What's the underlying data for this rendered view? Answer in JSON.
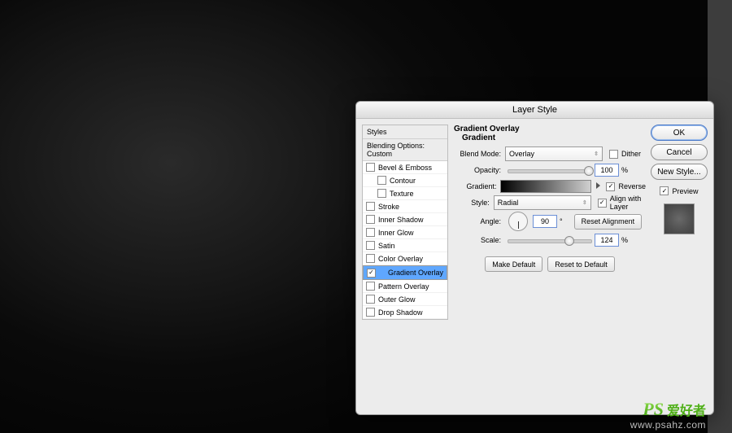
{
  "dialog": {
    "title": "Layer Style",
    "left_panel": {
      "header1": "Styles",
      "header2": "Blending Options: Custom",
      "items": [
        {
          "label": "Bevel & Emboss",
          "checked": false,
          "sub": false
        },
        {
          "label": "Contour",
          "checked": false,
          "sub": true
        },
        {
          "label": "Texture",
          "checked": false,
          "sub": true
        },
        {
          "label": "Stroke",
          "checked": false,
          "sub": false
        },
        {
          "label": "Inner Shadow",
          "checked": false,
          "sub": false
        },
        {
          "label": "Inner Glow",
          "checked": false,
          "sub": false
        },
        {
          "label": "Satin",
          "checked": false,
          "sub": false
        },
        {
          "label": "Color Overlay",
          "checked": false,
          "sub": false
        },
        {
          "label": "Gradient Overlay",
          "checked": true,
          "sub": false,
          "selected": true
        },
        {
          "label": "Pattern Overlay",
          "checked": false,
          "sub": false
        },
        {
          "label": "Outer Glow",
          "checked": false,
          "sub": false
        },
        {
          "label": "Drop Shadow",
          "checked": false,
          "sub": false
        }
      ]
    },
    "mid": {
      "group_title": "Gradient Overlay",
      "group_sub": "Gradient",
      "blend_mode_label": "Blend Mode:",
      "blend_mode_value": "Overlay",
      "dither_label": "Dither",
      "dither_checked": false,
      "opacity_label": "Opacity:",
      "opacity_value": "100",
      "opacity_unit": "%",
      "gradient_label": "Gradient:",
      "reverse_label": "Reverse",
      "reverse_checked": true,
      "style_label": "Style:",
      "style_value": "Radial",
      "align_label": "Align with Layer",
      "align_checked": true,
      "angle_label": "Angle:",
      "angle_value": "90",
      "angle_unit": "°",
      "reset_align": "Reset Alignment",
      "scale_label": "Scale:",
      "scale_value": "124",
      "scale_unit": "%",
      "make_default": "Make Default",
      "reset_default": "Reset to Default"
    },
    "right": {
      "ok": "OK",
      "cancel": "Cancel",
      "new_style": "New Style...",
      "preview_label": "Preview",
      "preview_checked": true
    }
  },
  "watermark": {
    "brand": "PS",
    "cn": "爱好者",
    "url": "www.psahz.com"
  }
}
